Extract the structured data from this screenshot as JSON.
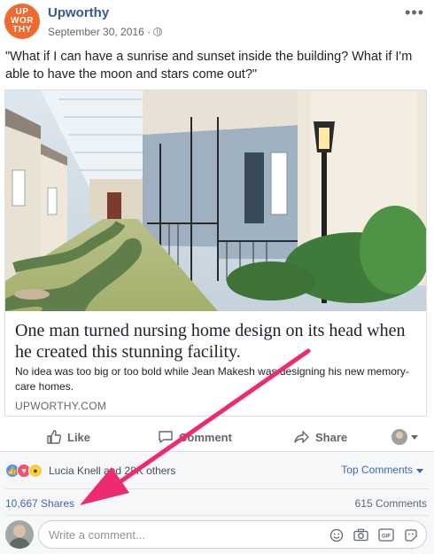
{
  "post": {
    "page_name": "Upworthy",
    "avatar_text": "UP\nWOR\nTHY",
    "date": "September 30, 2016 ·",
    "audience_icon": "globe-icon",
    "more_icon": "more-horizontal-icon",
    "text": "\"What if I can have a sunrise and sunset inside the building? What if I'm able to have the moon and stars come out?\""
  },
  "link_card": {
    "title": "One man turned nursing home design on its head when he created this stunning facility.",
    "description": "No idea was too big or too bold while Jean Makesh was designing his new memory-care homes.",
    "domain": "UPWORTHY.COM"
  },
  "actions": {
    "like": "Like",
    "comment": "Comment",
    "share": "Share"
  },
  "footer": {
    "reactions": [
      "like",
      "love",
      "wow"
    ],
    "reaction_names": "Lucia Knell and 28K others",
    "top_comments": "Top Comments",
    "shares": "10,667 Shares",
    "comment_count": "615 Comments",
    "comment_placeholder": "Write a comment...",
    "comment_tool_icons": [
      "emoji-icon",
      "camera-icon",
      "gif-icon",
      "sticker-icon"
    ]
  },
  "colors": {
    "brand_blue": "#365899",
    "link_blue": "#4267b2",
    "upworthy_orange": "#ef6a2e",
    "annotation_arrow": "#ee2a72"
  }
}
